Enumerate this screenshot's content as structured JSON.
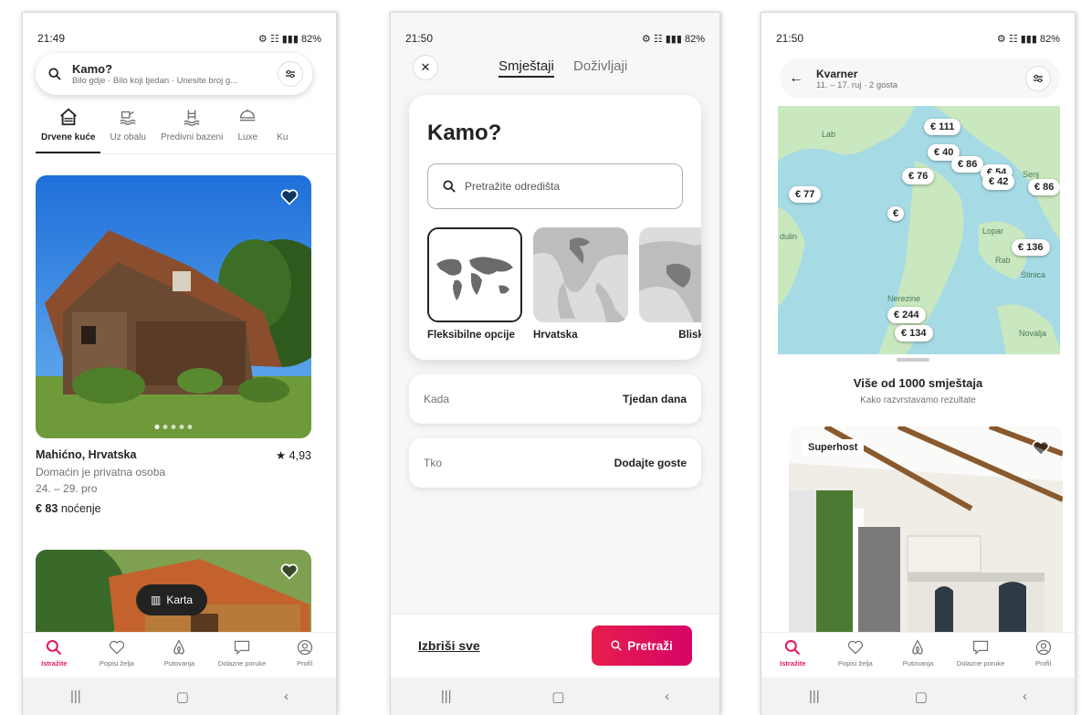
{
  "screen1": {
    "status": {
      "time": "21:49",
      "right": "82%"
    },
    "search": {
      "title": "Kamo?",
      "subtitle": "Bilo gdje · Bilo koji tjedan · Unesite broj g..."
    },
    "categories": [
      {
        "label": "Drvene kuće",
        "icon": "cabin-icon",
        "active": true
      },
      {
        "label": "Uz obalu",
        "icon": "beach-icon",
        "active": false
      },
      {
        "label": "Predivni bazeni",
        "icon": "pool-icon",
        "active": false
      },
      {
        "label": "Luxe",
        "icon": "luxe-icon",
        "active": false
      },
      {
        "label": "Ku",
        "icon": "partial-icon",
        "active": false
      }
    ],
    "listing": {
      "location": "Mahićno, Hrvatska",
      "rating": "★ 4,93",
      "host": "Domaćin je privatna osoba",
      "dates": "24. – 29. pro",
      "price_amount": "€ 83",
      "price_unit": "noćenje"
    },
    "map_button": "Karta"
  },
  "screen2": {
    "status": {
      "time": "21:50",
      "right": "82%"
    },
    "tabs": {
      "stays": "Smještaji",
      "experiences": "Doživljaji"
    },
    "title": "Kamo?",
    "search_placeholder": "Pretražite odredišta",
    "regions": [
      {
        "label": "Fleksibilne opcije"
      },
      {
        "label": "Hrvatska"
      },
      {
        "label": "Bliski istok"
      }
    ],
    "when": {
      "label": "Kada",
      "value": "Tjedan dana"
    },
    "who": {
      "label": "Tko",
      "value": "Dodajte goste"
    },
    "clear_all": "Izbriši sve",
    "search_button": "Pretraži"
  },
  "screen3": {
    "status": {
      "time": "21:50",
      "right": "82%"
    },
    "header": {
      "title": "Kvarner",
      "subtitle": "11. – 17. ruj · 2 gosta"
    },
    "map_pins": [
      "€ 111",
      "€ 40",
      "€ 86",
      "€ 76",
      "€ 54",
      "€ 42",
      "€ 86",
      "€ 77",
      "€ 136",
      "€ 244",
      "€ 134",
      "€"
    ],
    "map_labels": [
      "Lab",
      "dulin",
      "Senj",
      "Lopar",
      "Rab",
      "Stinica",
      "Nerezine",
      "Novalja"
    ],
    "results": "Više od 1000 smještaja",
    "sort_note": "Kako razvrstavamo rezultate",
    "badge": "Superhost"
  },
  "nav": {
    "items": [
      "Istražite",
      "Popisi želja",
      "Putovanja",
      "Dolazne poruke",
      "Profil"
    ]
  },
  "colors": {
    "accent": "#e31c5f",
    "button": "#e61e4d"
  }
}
